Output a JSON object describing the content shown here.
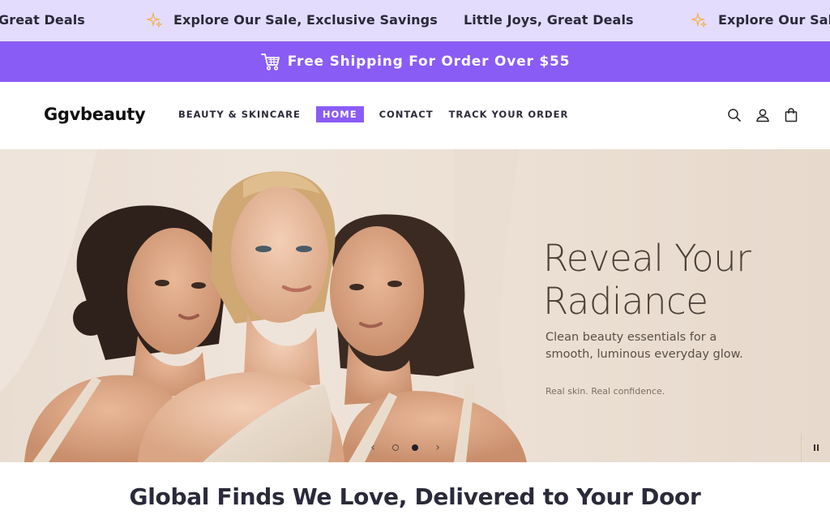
{
  "marquee": {
    "items": [
      "Great Deals",
      "Explore Our Sale, Exclusive Savings",
      "Little Joys, Great Deals",
      "Explore Our Sale"
    ],
    "star_icon": "sparkle-icon"
  },
  "shipping_bar": {
    "icon": "cart-icon",
    "text": "Free Shipping For Order Over $55"
  },
  "header": {
    "logo": "Ggvbeauty",
    "nav": [
      {
        "label": "BEAUTY & SKINCARE",
        "active": false
      },
      {
        "label": "HOME",
        "active": true
      },
      {
        "label": "CONTACT",
        "active": false
      },
      {
        "label": "TRACK YOUR ORDER",
        "active": false
      }
    ],
    "icons": [
      "search-icon",
      "account-icon",
      "cart-bag-icon"
    ]
  },
  "hero": {
    "title_line1": "Reveal Your",
    "title_line2": "Radiance",
    "subtitle": "Clean beauty essentials for a smooth, luminous everyday glow.",
    "tagline": "Real skin. Real confidence.",
    "slider": {
      "prev": "‹",
      "next": "›",
      "slides": 2,
      "active_slide": 2
    },
    "pause_label": "pause"
  },
  "section": {
    "title": "Global Finds We Love, Delivered to Your Door"
  },
  "colors": {
    "marquee_bg": "#e3dcfd",
    "accent": "#8a5cf6",
    "text": "#2a2a3a"
  }
}
